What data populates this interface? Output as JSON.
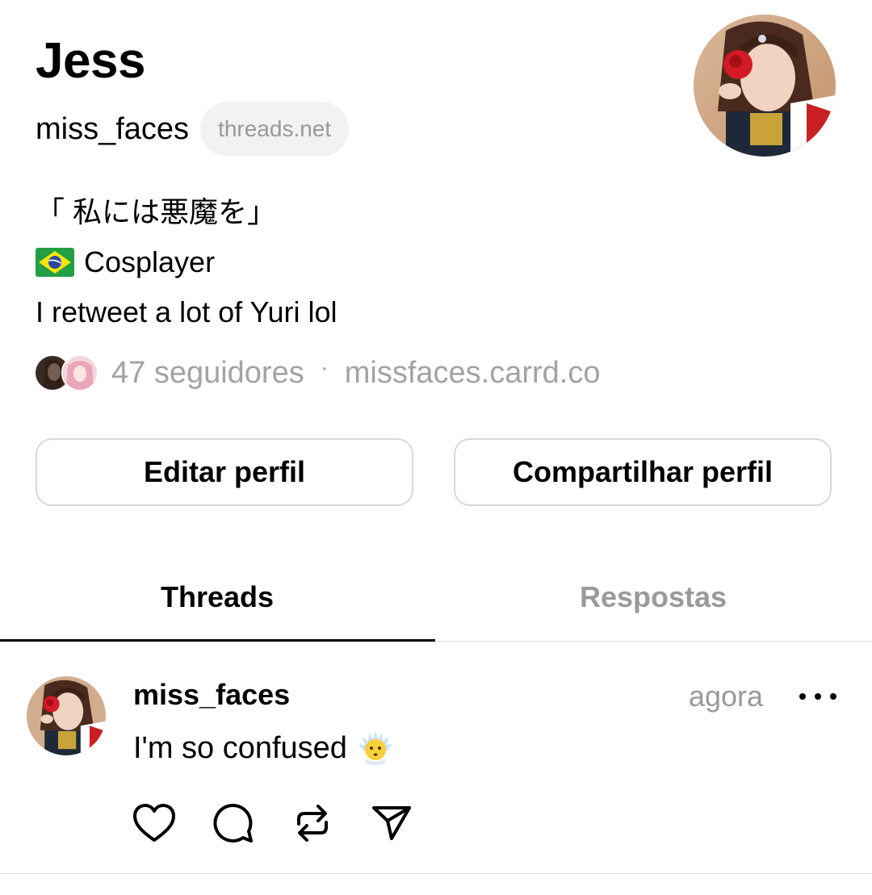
{
  "profile": {
    "display_name": "Jess",
    "handle": "miss_faces",
    "domain_badge": "threads.net",
    "avatar": "profile-photo"
  },
  "bio": {
    "line1": "「 私には悪魔を」",
    "line2": "Cosplayer",
    "line3": "I retweet a lot of Yuri lol"
  },
  "meta": {
    "followers": "47 seguidores",
    "separator": "·",
    "link": "missfaces.carrd.co"
  },
  "buttons": {
    "edit": "Editar perfil",
    "share": "Compartilhar perfil"
  },
  "tabs": [
    {
      "label": "Threads",
      "active": true
    },
    {
      "label": "Respostas",
      "active": false
    }
  ],
  "post": {
    "author": "miss_faces",
    "time": "agora",
    "text": "I'm so confused",
    "emoji": "confused-face-emoji",
    "actions": [
      "heart-icon",
      "comment-icon",
      "repost-icon",
      "send-icon"
    ]
  },
  "colors": {
    "muted": "#9a9a9a",
    "pill_bg": "#f2f2f2",
    "border": "#d9d9d9"
  }
}
